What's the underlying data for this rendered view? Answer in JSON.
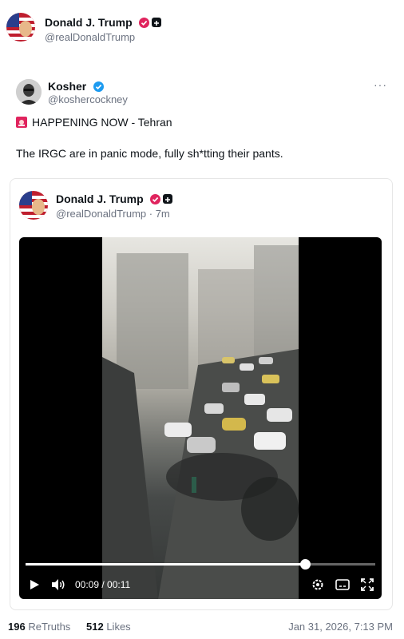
{
  "outer_post": {
    "author_name": "Donald J. Trump",
    "author_handle": "@realDonaldTrump",
    "retruths_count": "196",
    "retruths_label": "ReTruths",
    "likes_count": "512",
    "likes_label": "Likes",
    "timestamp": "Jan 31, 2026, 7:13 PM"
  },
  "quoted_post": {
    "author_name": "Kosher",
    "author_handle": "@koshercockney",
    "more_menu": "···",
    "headline_emoji": "siren-icon",
    "headline": "HAPPENING NOW - Tehran",
    "body": "The IRGC are in panic mode, fully sh*tting their pants."
  },
  "embedded_post": {
    "author_name": "Donald J. Trump",
    "author_handle": "@realDonaldTrump · 7m"
  },
  "video": {
    "time_display": "00:09 / 00:11",
    "progress": 0.8,
    "controls": [
      "play-icon",
      "volume-icon",
      "settings-icon",
      "captions-icon",
      "fullscreen-icon"
    ]
  },
  "colors": {
    "verified_red": "#e0245e",
    "verified_blue": "#1d9bf0",
    "text_gray": "#6b7280"
  }
}
